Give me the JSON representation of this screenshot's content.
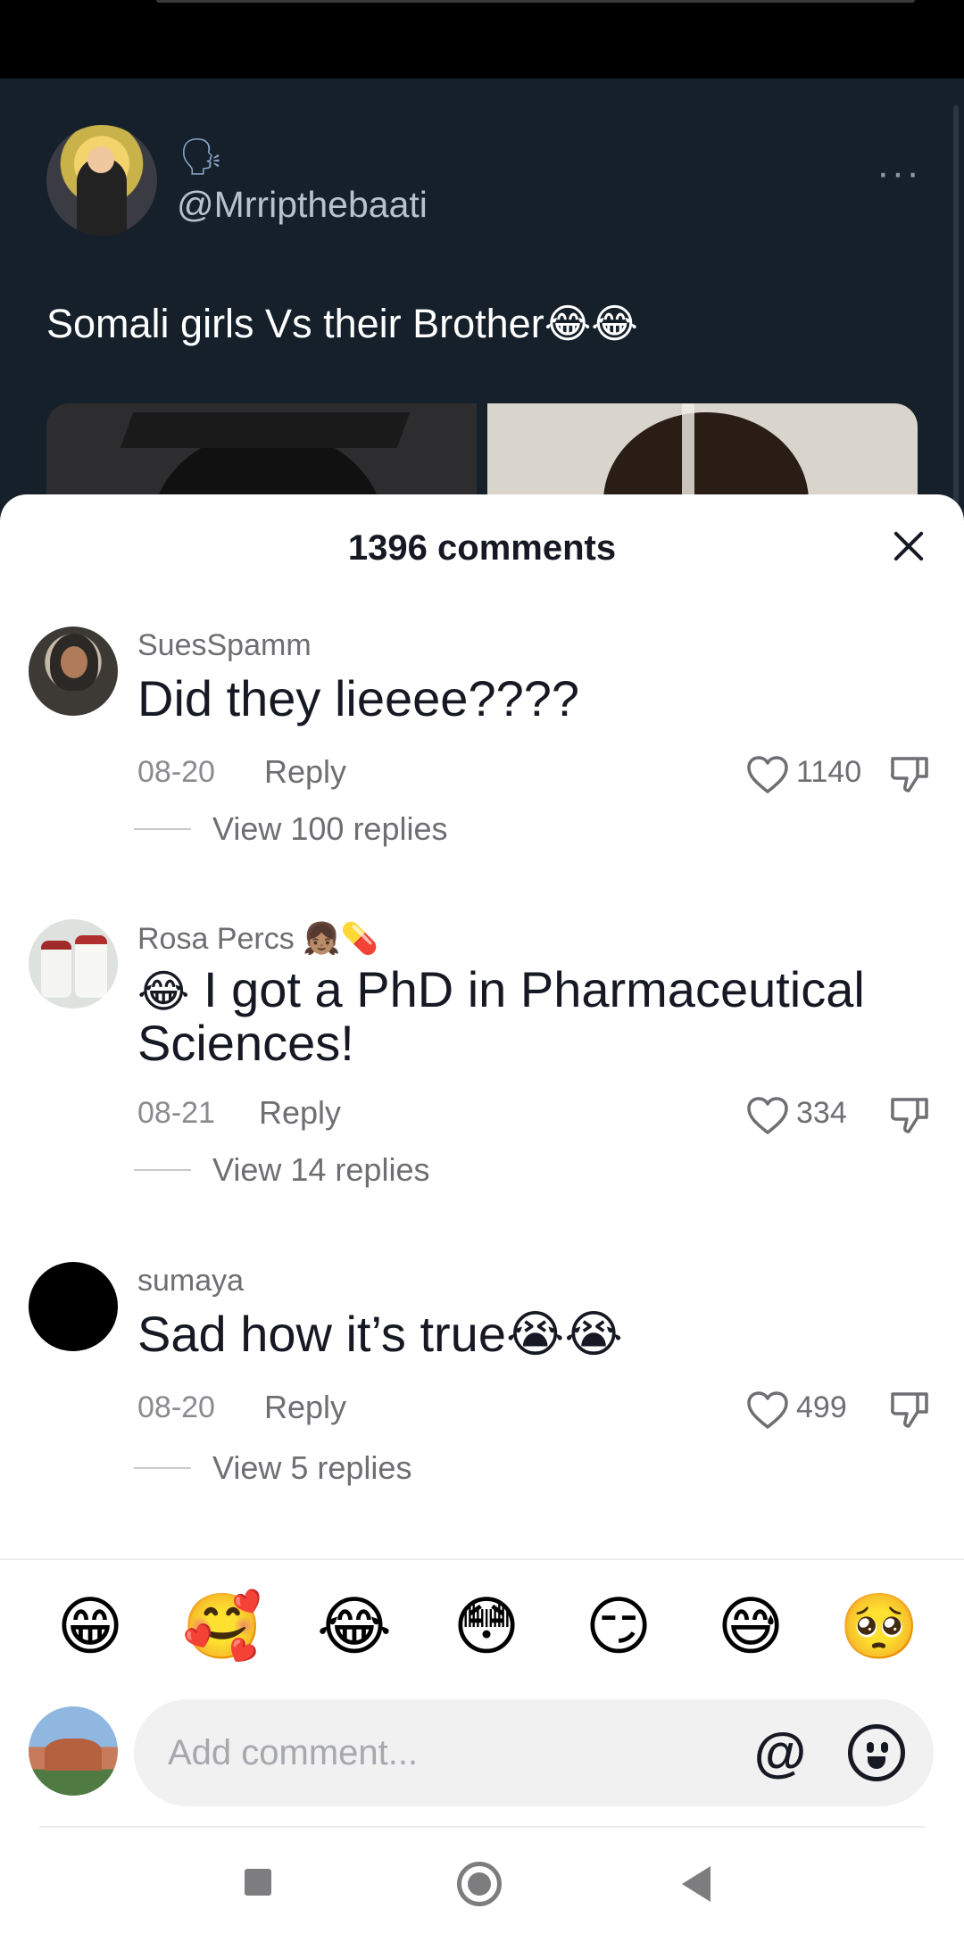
{
  "post": {
    "handle": "@Mrripthebaati",
    "speaker_emoji": "🗣",
    "text": "Somali girls Vs their Brother😂😂",
    "more_label": "···"
  },
  "sheet": {
    "title": "1396 comments"
  },
  "comments": [
    {
      "user": "SuesSpamm",
      "user_suffix": "",
      "text_prefix": "",
      "text": "Did they lieeee????",
      "date": "08-20",
      "reply_label": "Reply",
      "likes": "1140",
      "view_replies": "View 100 replies"
    },
    {
      "user": "Rosa Percs",
      "user_suffix": "👧🏽💊",
      "text_prefix": "😂",
      "text": " I got a PhD in Pharmaceutical Sciences!",
      "date": "08-21",
      "reply_label": "Reply",
      "likes": "334",
      "view_replies": "View 14 replies"
    },
    {
      "user": "sumaya",
      "user_suffix": "",
      "text_prefix": "",
      "text": "Sad how it’s true😭😭",
      "date": "08-20",
      "reply_label": "Reply",
      "likes": "499",
      "view_replies": "View 5 replies"
    }
  ],
  "quick_emojis": [
    "😁",
    "🥰",
    "😂",
    "😳",
    "😏",
    "😅",
    "🥺"
  ],
  "composer": {
    "placeholder": "Add comment...",
    "at_label": "@"
  },
  "icons": {
    "close": "close-icon",
    "like": "heart-icon",
    "dislike": "dislike-icon",
    "mention": "at-icon",
    "emoji": "emoji-icon",
    "nav": [
      "recents-square-icon",
      "home-circle-icon",
      "back-triangle-icon"
    ]
  },
  "colors": {
    "post_bg": "#15202b",
    "sheet_bg": "#ffffff",
    "text_primary": "#161823",
    "text_secondary": "#6e6e73"
  }
}
